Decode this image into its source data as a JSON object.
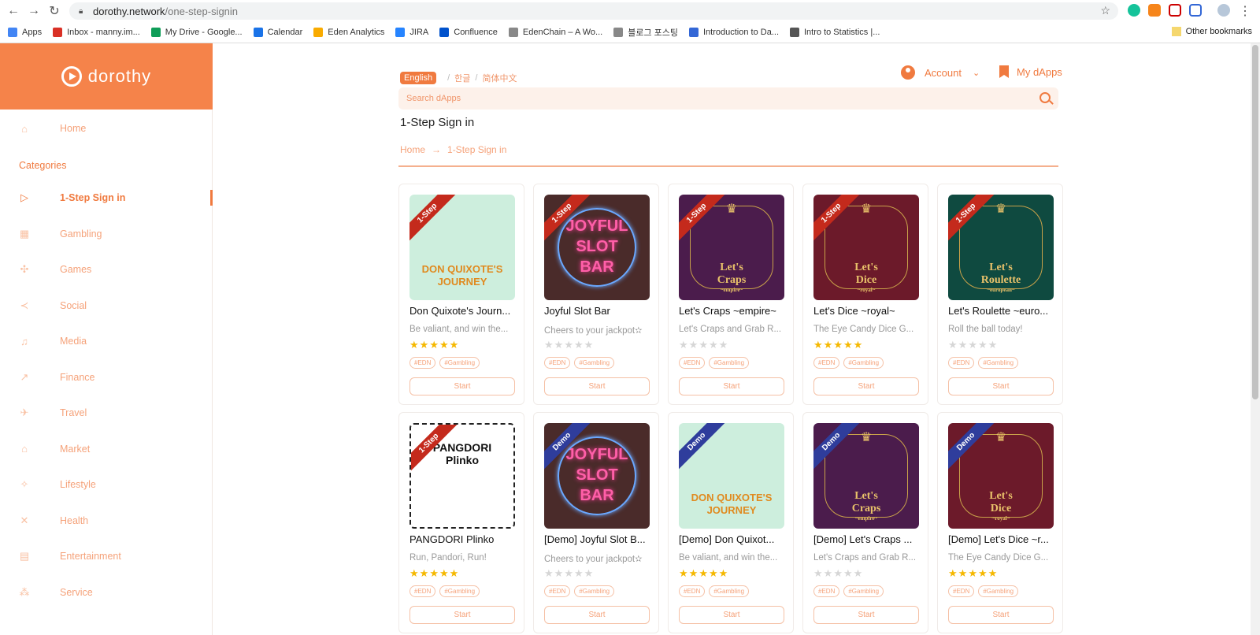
{
  "browser": {
    "url_host": "dorothy.network",
    "url_path": "/one-step-signin",
    "bookmarks": [
      {
        "label": "Apps",
        "color": "#4285f4"
      },
      {
        "label": "Inbox - manny.im...",
        "color": "#d93025"
      },
      {
        "label": "My Drive - Google...",
        "color": "#0f9d58"
      },
      {
        "label": "Calendar",
        "color": "#1a73e8"
      },
      {
        "label": "Eden Analytics",
        "color": "#f9ab00"
      },
      {
        "label": "JIRA",
        "color": "#2684ff"
      },
      {
        "label": "Confluence",
        "color": "#0052cc"
      },
      {
        "label": "EdenChain – A Wo...",
        "color": "#888888"
      },
      {
        "label": "블로그 포스팅",
        "color": "#888888"
      },
      {
        "label": "Introduction to Da...",
        "color": "#3367d6"
      },
      {
        "label": "Intro to Statistics |...",
        "color": "#555555"
      }
    ],
    "other_bookmarks": "Other bookmarks"
  },
  "sidebar": {
    "brand": "dorothy",
    "home": "Home",
    "categories_title": "Categories",
    "items": [
      {
        "label": "1-Step Sign in",
        "icon": "play-circle-icon",
        "glyph": "▷"
      },
      {
        "label": "Gambling",
        "icon": "grid-icon",
        "glyph": "▦"
      },
      {
        "label": "Games",
        "icon": "gamepad-icon",
        "glyph": "✣"
      },
      {
        "label": "Social",
        "icon": "share-icon",
        "glyph": "≺"
      },
      {
        "label": "Media",
        "icon": "microphone-icon",
        "glyph": "♫"
      },
      {
        "label": "Finance",
        "icon": "trend-icon",
        "glyph": "↗"
      },
      {
        "label": "Travel",
        "icon": "plane-icon",
        "glyph": "✈"
      },
      {
        "label": "Market",
        "icon": "shop-icon",
        "glyph": "⌂"
      },
      {
        "label": "Lifestyle",
        "icon": "person-icon",
        "glyph": "✧"
      },
      {
        "label": "Health",
        "icon": "health-icon",
        "glyph": "✕"
      },
      {
        "label": "Entertainment",
        "icon": "film-icon",
        "glyph": "▤"
      },
      {
        "label": "Service",
        "icon": "service-icon",
        "glyph": "⁂"
      }
    ]
  },
  "header": {
    "languages": [
      "English",
      "한글",
      "简体中文"
    ],
    "account": "Account",
    "my_dapps": "My dApps",
    "search_placeholder": "Search dApps"
  },
  "page": {
    "title": "1-Step Sign in",
    "breadcrumb": [
      "Home",
      "1-Step Sign in"
    ],
    "arrow": "→"
  },
  "cards": [
    {
      "name": "Don Quixote's Journ...",
      "desc": "Be valiant, and win the...",
      "stars": 5,
      "ribbon": "1-Step",
      "kind": "step",
      "art": "quixote",
      "tags": [
        "#EDN",
        "#Gambling"
      ],
      "start": "Start"
    },
    {
      "name": "Joyful Slot Bar",
      "desc": "Cheers to your jackpot✫",
      "stars": 0,
      "ribbon": "1-Step",
      "kind": "step",
      "art": "slot",
      "tags": [
        "#EDN",
        "#Gambling"
      ],
      "start": "Start"
    },
    {
      "name": "Let's Craps ~empire~",
      "desc": "Let's Craps and Grab R...",
      "stars": 0,
      "ribbon": "1-Step",
      "kind": "step",
      "art": "craps",
      "tags": [
        "#EDN",
        "#Gambling"
      ],
      "start": "Start"
    },
    {
      "name": "Let's Dice ~royal~",
      "desc": "The Eye Candy Dice G...",
      "stars": 5,
      "ribbon": "1-Step",
      "kind": "step",
      "art": "dice",
      "tags": [
        "#EDN",
        "#Gambling"
      ],
      "start": "Start"
    },
    {
      "name": "Let's Roulette ~euro...",
      "desc": "Roll the ball today!",
      "stars": 0,
      "ribbon": "1-Step",
      "kind": "step",
      "art": "roulette",
      "tags": [
        "#EDN",
        "#Gambling"
      ],
      "start": "Start"
    },
    {
      "name": "PANGDORI Plinko",
      "desc": "Run, Pandori, Run!",
      "stars": 5,
      "ribbon": "1-Step",
      "kind": "step",
      "art": "plinko",
      "tags": [
        "#EDN",
        "#Gambling"
      ],
      "start": "Start"
    },
    {
      "name": "[Demo] Joyful Slot B...",
      "desc": "Cheers to your jackpot✫",
      "stars": 0,
      "ribbon": "Demo",
      "kind": "demo",
      "art": "slot",
      "tags": [
        "#EDN",
        "#Gambling"
      ],
      "start": "Start"
    },
    {
      "name": "[Demo] Don Quixot...",
      "desc": "Be valiant, and win the...",
      "stars": 5,
      "ribbon": "Demo",
      "kind": "demo",
      "art": "quixote",
      "tags": [
        "#EDN",
        "#Gambling"
      ],
      "start": "Start"
    },
    {
      "name": "[Demo] Let's Craps ...",
      "desc": "Let's Craps and Grab R...",
      "stars": 0,
      "ribbon": "Demo",
      "kind": "demo",
      "art": "craps",
      "tags": [
        "#EDN",
        "#Gambling"
      ],
      "start": "Start"
    },
    {
      "name": "[Demo] Let's Dice ~r...",
      "desc": "The Eye Candy Dice G...",
      "stars": 5,
      "ribbon": "Demo",
      "kind": "demo",
      "art": "dice",
      "tags": [
        "#EDN",
        "#Gambling"
      ],
      "start": "Start"
    }
  ],
  "art": {
    "quixote": {
      "bg": "#cdeedd",
      "lines": [
        "DON QUIXOTE'S",
        "JOURNEY"
      ],
      "color": "#e08a1f"
    },
    "slot": {
      "bg": "#4a2b2a",
      "lines": [
        "JOYFUL",
        "SLOT",
        "BAR"
      ],
      "color": "#ff5fa8"
    },
    "craps": {
      "bg": "#4b1c4c",
      "lines": [
        "Let's",
        "Craps",
        "~empire~"
      ],
      "color": "#e9c26a"
    },
    "dice": {
      "bg": "#6c1a2a",
      "lines": [
        "Let's",
        "Dice",
        "~royal~"
      ],
      "color": "#e9c26a"
    },
    "roulette": {
      "bg": "#0f4a40",
      "lines": [
        "Let's",
        "Roulette",
        "~european~"
      ],
      "color": "#e9c26a"
    },
    "plinko": {
      "bg": "#ffffff",
      "lines": [
        "PANGDORI",
        "Plinko"
      ],
      "color": "#111111"
    }
  },
  "colors": {
    "accent": "#f07a3f",
    "brand_bg": "#f5834a",
    "star": "#f5b800"
  }
}
